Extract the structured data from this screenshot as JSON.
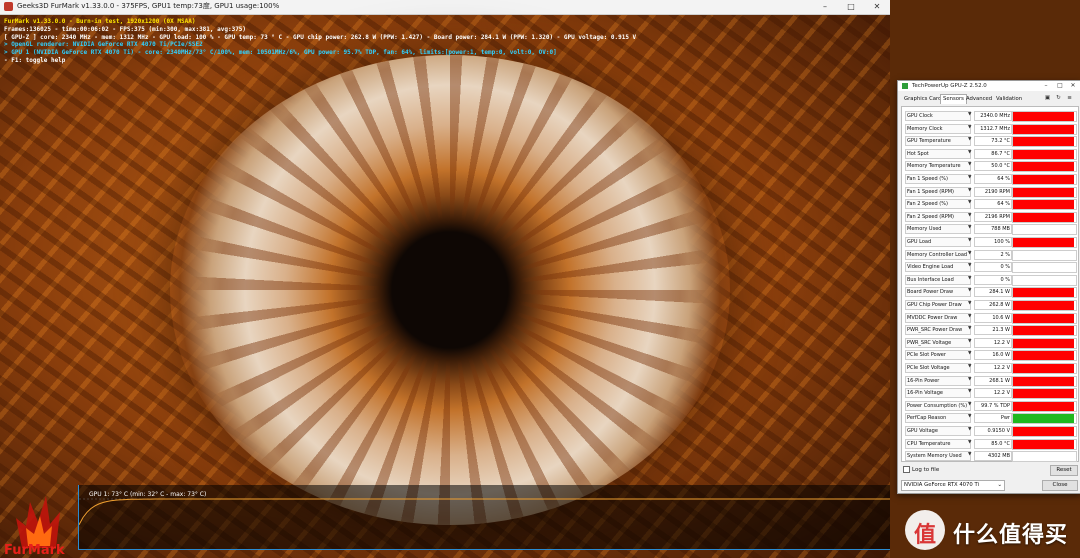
{
  "furmark": {
    "title": "Geeks3D FurMark v1.33.0.0 - 375FPS, GPU1 temp:73度, GPU1 usage:100%",
    "window_controls": [
      "–",
      "□",
      "✕"
    ],
    "osd": {
      "line1": "FurMark v1.33.0.0 - Burn-in test, 1920x1200 (0X MSAA)",
      "line2": "Frames:136025 - time:00:06:02 - FPS:375 (min:300, max:381, avg:375)",
      "line3": "[ GPU-Z ] core: 2340 MHz - mem: 1312 MHz - GPU load: 100 % - GPU temp: 73 ° C - GPU chip power: 262.8 W (PPW: 1.427) - Board power: 284.1 W (PPW: 1.320) - GPU voltage: 0.915 V",
      "line4": "> OpenGL renderer: NVIDIA GeForce RTX 4070 Ti/PCIe/SSE2",
      "line5": "> GPU 1 (NVIDIA GeForce RTX 4070 Ti) - core: 2340MHz/73° C/100%, mem: 10501MHz/6%, GPU power: 95.7% TDP, fan: 64%, limits:[power:1, temp:0, volt:0, OV:0]",
      "line6": "- F1: toggle help"
    },
    "graph_label": "GPU 1: 73° C (min: 32° C - max: 73° C)",
    "logo_text": "FurMark",
    "graph_temp_series": {
      "min": 32,
      "max": 73,
      "current": 73
    }
  },
  "gpuz": {
    "title": "TechPowerUp GPU-Z 2.52.0",
    "tabs": [
      "Graphics Card",
      "Sensors",
      "Advanced",
      "Validation"
    ],
    "active_tab": "Sensors",
    "toolbar_icons": [
      "camera-icon",
      "refresh-icon",
      "menu-icon"
    ],
    "sensors": [
      {
        "name": "GPU Clock",
        "value": "2340.0 MHz",
        "level": 0.97,
        "color": "#ff0000"
      },
      {
        "name": "Memory Clock",
        "value": "1312.7 MHz",
        "level": 0.97,
        "color": "#ff0000"
      },
      {
        "name": "GPU Temperature",
        "value": "73.2 °C",
        "level": 0.97,
        "color": "#ff0000"
      },
      {
        "name": "Hot Spot",
        "value": "86.7 °C",
        "level": 0.97,
        "color": "#ff0000"
      },
      {
        "name": "Memory Temperature",
        "value": "50.0 °C",
        "level": 0.97,
        "color": "#ff0000"
      },
      {
        "name": "Fan 1 Speed (%)",
        "value": "64 %",
        "level": 0.97,
        "color": "#ff0000"
      },
      {
        "name": "Fan 1 Speed (RPM)",
        "value": "2190 RPM",
        "level": 0.97,
        "color": "#ff0000"
      },
      {
        "name": "Fan 2 Speed (%)",
        "value": "64 %",
        "level": 0.97,
        "color": "#ff0000"
      },
      {
        "name": "Fan 2 Speed (RPM)",
        "value": "2196 RPM",
        "level": 0.97,
        "color": "#ff0000"
      },
      {
        "name": "Memory Used",
        "value": "788 MB",
        "level": 0.0,
        "color": "#ff0000"
      },
      {
        "name": "GPU Load",
        "value": "100 %",
        "level": 0.97,
        "color": "#ff0000"
      },
      {
        "name": "Memory Controller Load",
        "value": "2 %",
        "level": 0.0,
        "color": "#ff0000"
      },
      {
        "name": "Video Engine Load",
        "value": "0 %",
        "level": 0.0,
        "color": "#ff0000"
      },
      {
        "name": "Bus Interface Load",
        "value": "0 %",
        "level": 0.0,
        "color": "#ff0000"
      },
      {
        "name": "Board Power Draw",
        "value": "284.1 W",
        "level": 0.97,
        "color": "#ff0000"
      },
      {
        "name": "GPU Chip Power Draw",
        "value": "262.8 W",
        "level": 0.97,
        "color": "#ff0000"
      },
      {
        "name": "MVDDC Power Draw",
        "value": "10.6 W",
        "level": 0.97,
        "color": "#ff0000"
      },
      {
        "name": "PWR_SRC Power Draw",
        "value": "21.3 W",
        "level": 0.97,
        "color": "#ff0000"
      },
      {
        "name": "PWR_SRC Voltage",
        "value": "12.2 V",
        "level": 0.97,
        "color": "#ff0000"
      },
      {
        "name": "PCIe Slot Power",
        "value": "16.0 W",
        "level": 0.97,
        "color": "#ff0000"
      },
      {
        "name": "PCIe Slot Voltage",
        "value": "12.2 V",
        "level": 0.97,
        "color": "#ff0000"
      },
      {
        "name": "16-Pin Power",
        "value": "268.1 W",
        "level": 0.97,
        "color": "#ff0000"
      },
      {
        "name": "16-Pin Voltage",
        "value": "12.2 V",
        "level": 0.97,
        "color": "#ff0000"
      },
      {
        "name": "Power Consumption (%)",
        "value": "99.7 % TDP",
        "level": 0.97,
        "color": "#ff0000"
      },
      {
        "name": "PerfCap Reason",
        "value": "Pwr",
        "level": 0.97,
        "color": "#1fb81f"
      },
      {
        "name": "GPU Voltage",
        "value": "0.9150 V",
        "level": 0.97,
        "color": "#ff0000"
      },
      {
        "name": "CPU Temperature",
        "value": "85.0 °C",
        "level": 0.97,
        "color": "#ff0000"
      },
      {
        "name": "System Memory Used",
        "value": "4302 MB",
        "level": 0.0,
        "color": "#ff0000"
      }
    ],
    "log_to_file": "Log to file",
    "reset": "Reset",
    "gpu_select": "NVIDIA GeForce RTX 4070 Ti",
    "close": "Close"
  },
  "watermark": {
    "text": "什么值得买"
  }
}
